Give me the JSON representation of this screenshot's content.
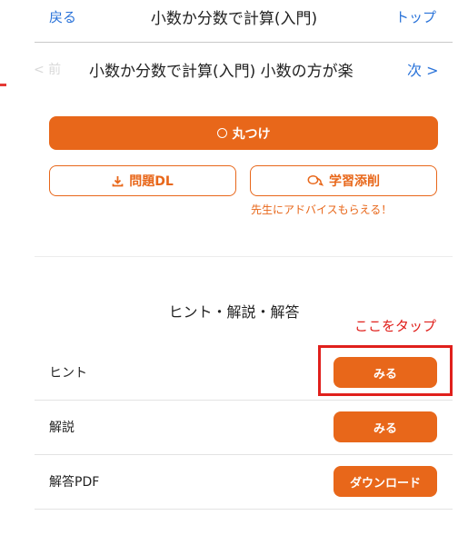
{
  "header": {
    "back_label": "戻る",
    "title": "小数か分数で計算(入門)",
    "top_label": "トップ"
  },
  "lesson_nav": {
    "prev_label": "< 前",
    "title": "小数か分数で計算(入門) 小数の方が楽",
    "next_label": "次 >"
  },
  "actions": {
    "grade_label": "丸つけ",
    "download_label": "問題DL",
    "coaching_label": "学習添削",
    "advice_text": "先生にアドバイスもらえる！"
  },
  "hints": {
    "section_title": "ヒント・解説・解答",
    "tap_note": "ここをタップ",
    "rows": [
      {
        "label": "ヒント",
        "button": "みる"
      },
      {
        "label": "解説",
        "button": "みる"
      },
      {
        "label": "解答PDF",
        "button": "ダウンロード"
      }
    ]
  },
  "colors": {
    "accent": "#e8671a",
    "link": "#2a73d9",
    "annotation_red": "#e0201c"
  }
}
